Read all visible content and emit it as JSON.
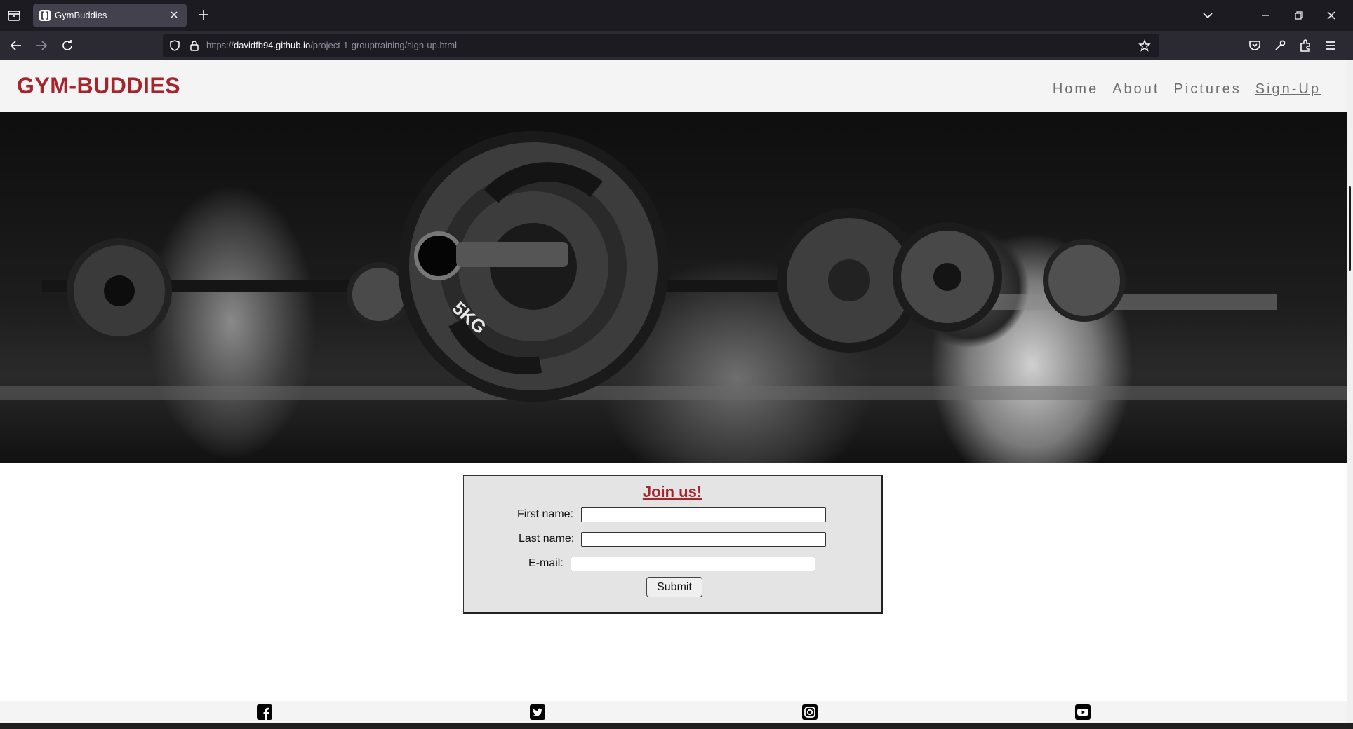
{
  "browser": {
    "tab_title": "GymBuddies",
    "url_host": "davidfb94.github.io",
    "url_prefix": "https://",
    "url_path": "/project-1-grouptraining/sign-up.html"
  },
  "site": {
    "brand": "GYM-BUDDIES",
    "nav": [
      "Home",
      "About",
      "Pictures",
      "Sign-Up"
    ],
    "active_nav": "Sign-Up"
  },
  "hero": {
    "plate_text": "5KG"
  },
  "form": {
    "title": "Join us!",
    "first_name_label": "First name:",
    "last_name_label": "Last name:",
    "email_label": "E-mail:",
    "first_name_value": "",
    "last_name_value": "",
    "email_value": "",
    "submit_label": "Submit"
  },
  "footer": {
    "icons": [
      "facebook-icon",
      "twitter-icon",
      "instagram-icon",
      "youtube-icon"
    ]
  },
  "colors": {
    "brand": "#a4262c",
    "chrome_dark": "#1c1b22",
    "chrome_toolbar": "#2b2a33"
  }
}
